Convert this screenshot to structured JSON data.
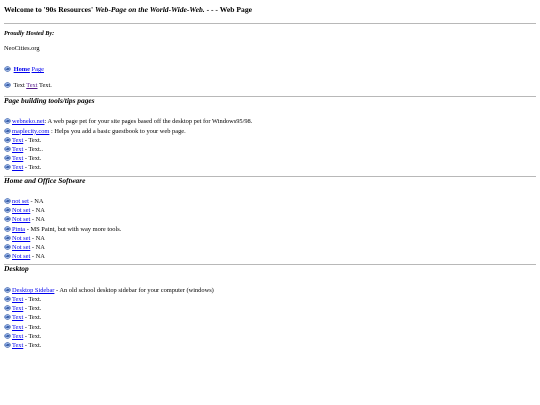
{
  "header": {
    "title_plain": "Welcome to '90s Resources'",
    "title_italic": "Web-Page on the World-Wide-Web.",
    "title_tail": "- - - Web Page"
  },
  "hosted": {
    "heading": "Proudly Hosted By:",
    "host": "NeoCities.org"
  },
  "home": {
    "link": "Home",
    "suffix": "Page"
  },
  "text_row": {
    "a": "Text",
    "link": "Text",
    "b": "Text."
  },
  "sections": {
    "tools": {
      "heading": "Page building tools/tips pages",
      "items": [
        {
          "link": "webneko.net",
          "desc": ": A web page pet for your site pages based off the desktop pet for Windows95/98."
        },
        {
          "link": "maplecity.com",
          "desc": " : Helps you add a basic guestbook to your web page."
        },
        {
          "link": "Text",
          "desc": " - Text."
        },
        {
          "link": "Text",
          "desc": " - Text.."
        },
        {
          "link": "Text",
          "desc": " - Text."
        },
        {
          "link": "Text",
          "desc": " - Text."
        }
      ]
    },
    "software": {
      "heading": "Home and Office Software",
      "items": [
        {
          "link": "not set",
          "desc": " - NA"
        },
        {
          "link": "Not set",
          "desc": " - NA"
        },
        {
          "link": "Not set",
          "desc": " - NA"
        },
        {
          "link": "Pinta",
          "desc": " - MS Paint, but with way more tools."
        },
        {
          "link": "Not set",
          "desc": " - NA"
        },
        {
          "link": "Not set",
          "desc": " - NA"
        },
        {
          "link": "Not set",
          "desc": " - NA"
        }
      ]
    },
    "desktop": {
      "heading": "Desktop",
      "items": [
        {
          "link": "Desktop Sidebar",
          "desc": " - An old school desktop sidebar for your computer (windows)"
        },
        {
          "link": "Text",
          "desc": " - Text."
        },
        {
          "link": "Text",
          "desc": " - Text."
        },
        {
          "link": "Text",
          "desc": " - Text."
        },
        {
          "link": "Text",
          "desc": " - Text."
        },
        {
          "link": "Text",
          "desc": " - Text."
        },
        {
          "link": "Text",
          "desc": " - Text."
        }
      ]
    }
  },
  "colors": {
    "link": "#0000ee",
    "visited": "#551a8b",
    "rule": "#b8b8b8",
    "icon": "#3a5fa8"
  },
  "icon_name": "globe-bullet-icon"
}
